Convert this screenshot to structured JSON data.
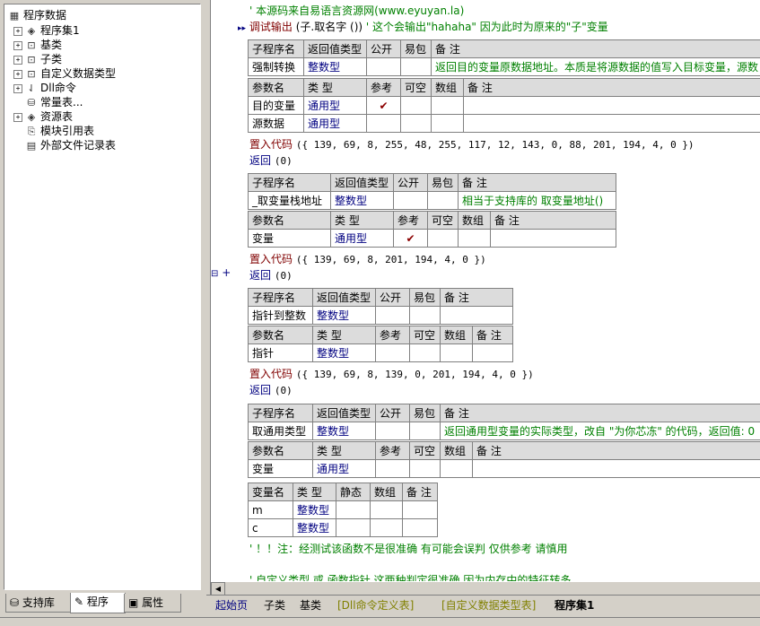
{
  "tree": {
    "root": "程序数据",
    "items": [
      {
        "label": "程序集1",
        "icon": "program-set-icon",
        "expandable": true
      },
      {
        "label": "基类",
        "icon": "class-icon",
        "expandable": true
      },
      {
        "label": "子类",
        "icon": "subclass-icon",
        "expandable": true
      },
      {
        "label": "自定义数据类型",
        "icon": "datatype-icon",
        "expandable": true
      },
      {
        "label": "Dll命令",
        "icon": "dll-icon",
        "expandable": true
      },
      {
        "label": "常量表...",
        "icon": "constant-table-icon",
        "expandable": false
      },
      {
        "label": "资源表",
        "icon": "resource-icon",
        "expandable": true
      },
      {
        "label": "模块引用表",
        "icon": "module-ref-icon",
        "expandable": false
      },
      {
        "label": "外部文件记录表",
        "icon": "external-file-icon",
        "expandable": false
      }
    ]
  },
  "left_tabs": [
    "支持库",
    "程序",
    "属性"
  ],
  "code": {
    "comment1": "' 本源码来自易语言资源网(www.eyuyan.la)",
    "debug_line": {
      "cmd": "调试输出",
      "args": "(子.取名字 ())",
      "comment": "' 这个会输出\"hahaha\" 因为此时为原来的\"子\"变量"
    },
    "sub_header": [
      "子程序名",
      "返回值类型",
      "公开",
      "易包",
      "备 注"
    ],
    "param_header": [
      "参数名",
      "类 型",
      "参考",
      "可空",
      "数组",
      "备 注"
    ],
    "subs": [
      {
        "name": "强制转换",
        "ret": "整数型",
        "note": "返回目的变量原数据地址。本质是将源数据的值写入目标变量，源数",
        "params": [
          {
            "name": "目的变量",
            "type": "通用型",
            "ref": "✔"
          },
          {
            "name": "源数据",
            "type": "通用型",
            "ref": ""
          }
        ],
        "embed_label": "置入代码",
        "embed_code": "({ 139, 69, 8, 255, 48, 255, 117, 12, 143, 0, 88, 201, 194, 4, 0 })",
        "return_label": "返回",
        "return_args": "(0)"
      },
      {
        "name": "_取变量栈地址",
        "ret": "整数型",
        "note": "相当于支持库的 取变量地址()",
        "params": [
          {
            "name": "变量",
            "type": "通用型",
            "ref": "✔"
          }
        ],
        "embed_label": "置入代码",
        "embed_code": "({ 139, 69, 8, 201, 194, 4, 0 })",
        "return_label": "返回",
        "return_args": "(0)"
      },
      {
        "name": "指针到整数",
        "ret": "整数型",
        "note": "",
        "params": [
          {
            "name": "指针",
            "type": "整数型",
            "ref": ""
          }
        ],
        "embed_label": "置入代码",
        "embed_code": "({ 139, 69, 8, 139, 0, 201, 194, 4, 0 })",
        "return_label": "返回",
        "return_args": "(0)"
      },
      {
        "name": "取通用类型",
        "ret": "整数型",
        "note": "返回通用型变量的实际类型，改自 \"为你芯冻\" 的代码，返回值: 0",
        "params": [
          {
            "name": "变量",
            "type": "通用型",
            "ref": ""
          }
        ]
      }
    ],
    "local_header": [
      "变量名",
      "类 型",
      "静态",
      "数组",
      "备 注"
    ],
    "locals": [
      {
        "name": "m",
        "type": "整数型"
      },
      {
        "name": "c",
        "type": "整数型"
      }
    ],
    "comment2": "' ！！注：经测试该函数不是很准确 有可能会误判 仅供参考 请慎用",
    "comment3": "' 自定义类型 或 函数指针 这两种判定很准确 因为内存中的特征转多",
    "gutter": "+"
  },
  "bottom_tabs": [
    "起始页",
    "子类",
    "基类",
    "[Dll命令定义表]",
    "[自定义数据类型表]",
    "程序集1"
  ]
}
